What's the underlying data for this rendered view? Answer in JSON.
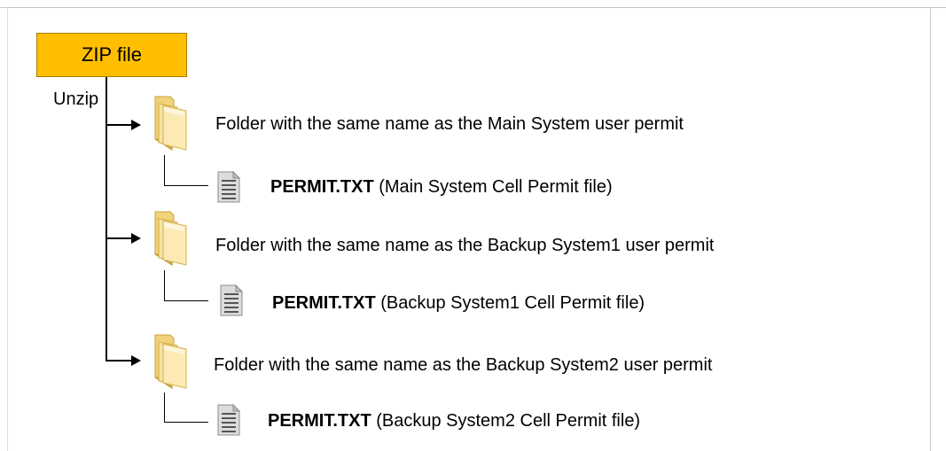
{
  "root": {
    "label": "ZIP file"
  },
  "action": {
    "label": "Unzip"
  },
  "entries": [
    {
      "folder_label": "Folder with the same name as the Main System user permit",
      "file_name": "PERMIT.TXT",
      "file_desc": "(Main System Cell Permit file)"
    },
    {
      "folder_label": "Folder with the same name as the Backup System1 user permit",
      "file_name": "PERMIT.TXT",
      "file_desc": "(Backup System1 Cell Permit file)"
    },
    {
      "folder_label": "Folder with the same name as the Backup System2 user permit",
      "file_name": "PERMIT.TXT",
      "file_desc": "(Backup System2 Cell Permit file)"
    }
  ],
  "colors": {
    "zip_box_fill": "#ffbf00",
    "folder_fill": "#f3dc86"
  },
  "icons": [
    "folder-icon",
    "text-file-icon",
    "arrow-right-icon"
  ]
}
